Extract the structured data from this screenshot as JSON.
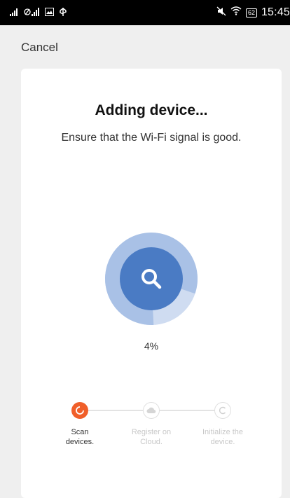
{
  "status_bar": {
    "left_icons": [
      "signal-icon",
      "signal-icon",
      "image-icon",
      "usb-icon"
    ],
    "right_icons": [
      "mute-icon",
      "wifi-icon",
      "battery-icon"
    ],
    "battery_level": "62",
    "time": "15:45"
  },
  "header": {
    "cancel_label": "Cancel"
  },
  "card": {
    "title": "Adding device...",
    "subtitle": "Ensure that the Wi-Fi signal is good.",
    "progress": {
      "percent_label": "4%",
      "value": 0.04,
      "icon": "search-icon"
    },
    "steps": [
      {
        "label_line1": "Scan",
        "label_line2": "devices.",
        "state": "active"
      },
      {
        "label_line1": "Register on",
        "label_line2": "Cloud.",
        "state": "pending"
      },
      {
        "label_line1": "Initialize the",
        "label_line2": "device.",
        "state": "pending"
      }
    ]
  },
  "colors": {
    "accent": "#4a7bc4",
    "ring": "#a9c1e6",
    "ring_light": "#cfdcf1",
    "active_step": "#f05f2a"
  }
}
